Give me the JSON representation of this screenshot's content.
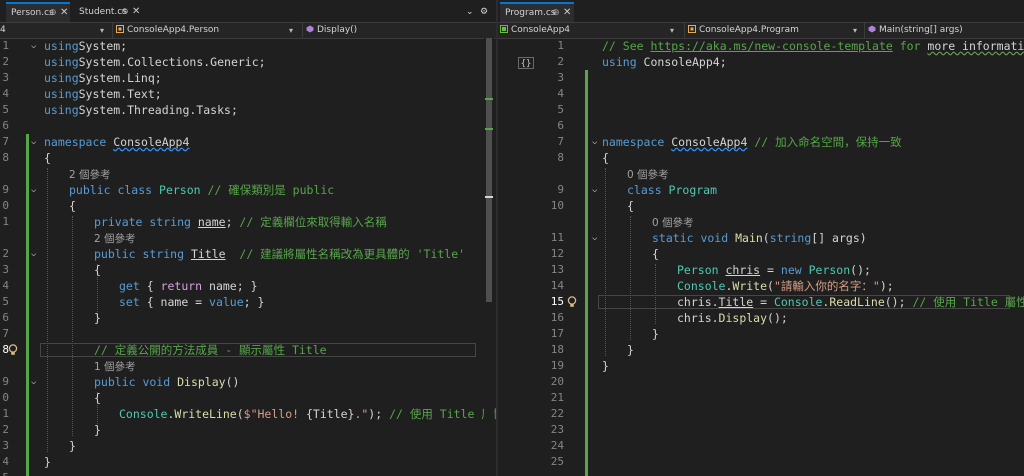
{
  "left": {
    "tabs": [
      {
        "label": "Person.cs",
        "active": true,
        "pin": "⊕",
        "close": "✕"
      },
      {
        "label": "Student.cs",
        "active": false,
        "pin": "⊕",
        "close": "✕"
      }
    ],
    "overflow_tab_icon": "⌄",
    "overflow_tab_icon_name": "tab-list-dropdown-icon",
    "settings_icon": "⚙",
    "settings_icon_name": "gear-icon",
    "nav": {
      "project": "4",
      "class": "ConsoleApp4.Person",
      "member": "Display()"
    },
    "lines": [
      {
        "n": "1",
        "fold": "⌵",
        "indent": 0,
        "segs": [
          [
            "kw",
            "using"
          ],
          [
            "",
            "System;"
          ]
        ]
      },
      {
        "n": "2",
        "indent": 0,
        "segs": [
          [
            "kw",
            "using"
          ],
          [
            "",
            "System.Collections.Generic;"
          ]
        ]
      },
      {
        "n": "3",
        "indent": 0,
        "segs": [
          [
            "kw",
            "using"
          ],
          [
            "",
            "System.Linq;"
          ]
        ]
      },
      {
        "n": "4",
        "indent": 0,
        "segs": [
          [
            "kw",
            "using"
          ],
          [
            "",
            "System.Text;"
          ]
        ]
      },
      {
        "n": "5",
        "indent": 0,
        "segs": [
          [
            "kw",
            "using"
          ],
          [
            "",
            "System.Threading.Tasks;"
          ]
        ]
      },
      {
        "n": "6",
        "indent": 0,
        "segs": []
      },
      {
        "n": "7",
        "fold": "⌵",
        "indent": 0,
        "segs": [
          [
            "kw",
            "namespace"
          ],
          [
            "",
            " "
          ],
          [
            "sq",
            "ConsoleApp4"
          ]
        ]
      },
      {
        "n": "8",
        "indent": 0,
        "segs": [
          [
            "",
            "{"
          ]
        ]
      },
      {
        "n": "",
        "indent": 1,
        "lens": "2 個參考"
      },
      {
        "n": "9",
        "fold": "⌵",
        "indent": 1,
        "segs": [
          [
            "kw",
            "public class "
          ],
          [
            "ty",
            "Person"
          ],
          [
            "cm",
            " // 確保類別是 public"
          ]
        ]
      },
      {
        "n": "0",
        "indent": 1,
        "segs": [
          [
            "",
            "{"
          ]
        ]
      },
      {
        "n": "1",
        "indent": 2,
        "segs": [
          [
            "kw",
            "private string "
          ],
          [
            "ul",
            "name"
          ],
          [
            "",
            ";"
          ],
          [
            "cm",
            " // 定義欄位來取得輸入名稱"
          ]
        ]
      },
      {
        "n": "",
        "indent": 2,
        "lens": "2 個參考"
      },
      {
        "n": "2",
        "fold": "⌵",
        "indent": 2,
        "segs": [
          [
            "kw",
            "public string "
          ],
          [
            "ul",
            "Title"
          ],
          [
            "cm",
            "  // 建議將屬性名稱改為更具體的 'Title'"
          ]
        ]
      },
      {
        "n": "3",
        "indent": 2,
        "segs": [
          [
            "",
            "{"
          ]
        ]
      },
      {
        "n": "4",
        "indent": 3,
        "segs": [
          [
            "kw",
            "get"
          ],
          [
            "",
            " { "
          ],
          [
            "ctl",
            "return"
          ],
          [
            "",
            " name; }"
          ]
        ]
      },
      {
        "n": "5",
        "indent": 3,
        "segs": [
          [
            "kw",
            "set"
          ],
          [
            "",
            " { name = "
          ],
          [
            "kw",
            "value"
          ],
          [
            "",
            "; }"
          ]
        ]
      },
      {
        "n": "6",
        "indent": 2,
        "segs": [
          [
            "",
            "}"
          ]
        ]
      },
      {
        "n": "7",
        "indent": 2,
        "segs": []
      },
      {
        "n": "8",
        "indent": 2,
        "current": true,
        "bulb": true,
        "segs": [
          [
            "cm",
            "// 定義公開的方法成員 - 顯示屬性 Title"
          ]
        ]
      },
      {
        "n": "",
        "indent": 2,
        "lens": "1 個參考"
      },
      {
        "n": "9",
        "fold": "⌵",
        "indent": 2,
        "segs": [
          [
            "kw",
            "public void "
          ],
          [
            "fn",
            "Display"
          ],
          [
            "",
            "()"
          ]
        ]
      },
      {
        "n": "0",
        "indent": 2,
        "segs": [
          [
            "",
            "{"
          ]
        ]
      },
      {
        "n": "1",
        "indent": 3,
        "segs": [
          [
            "ty",
            "Console"
          ],
          [
            "",
            "."
          ],
          [
            "fn",
            "WriteLine"
          ],
          [
            "",
            "("
          ],
          [
            "str",
            "$\"Hello! "
          ],
          [
            "",
            "{Title}"
          ],
          [
            "str",
            ".\""
          ],
          [
            "",
            ");"
          ],
          [
            "cm",
            " // 使用 Title 屬性"
          ]
        ]
      },
      {
        "n": "2",
        "indent": 2,
        "segs": [
          [
            "",
            "}"
          ]
        ]
      },
      {
        "n": "3",
        "indent": 1,
        "segs": [
          [
            "",
            "}"
          ]
        ]
      },
      {
        "n": "4",
        "indent": 0,
        "segs": [
          [
            "",
            "}"
          ]
        ]
      },
      {
        "n": "5",
        "indent": 0,
        "segs": []
      }
    ]
  },
  "right": {
    "tabs": [
      {
        "label": "Program.cs",
        "active": true,
        "pin": "⊕",
        "close": "✕"
      }
    ],
    "nav": {
      "project": "ConsoleApp4",
      "class": "ConsoleApp4.Program",
      "member": "Main(string[] args)"
    },
    "gutter_label": "{}",
    "lines": [
      {
        "n": "1",
        "indent": 0,
        "segs": [
          [
            "cm",
            "// See "
          ],
          [
            "lnk",
            "https://aka.ms/new-console-template"
          ],
          [
            "cm",
            " for "
          ],
          [
            "sqg",
            "more information"
          ]
        ]
      },
      {
        "n": "2",
        "indent": 0,
        "segs": [
          [
            "kw",
            "using"
          ],
          [
            "",
            " ConsoleApp4;"
          ]
        ]
      },
      {
        "n": "3",
        "indent": 0,
        "segs": []
      },
      {
        "n": "4",
        "indent": 0,
        "segs": []
      },
      {
        "n": "5",
        "indent": 0,
        "segs": []
      },
      {
        "n": "6",
        "indent": 0,
        "segs": []
      },
      {
        "n": "7",
        "fold": "⌵",
        "indent": 0,
        "segs": [
          [
            "kw",
            "namespace"
          ],
          [
            "",
            " "
          ],
          [
            "sq",
            "ConsoleApp4"
          ],
          [
            "cm",
            " // 加入命名空間，保持一致"
          ]
        ]
      },
      {
        "n": "8",
        "indent": 0,
        "segs": [
          [
            "",
            "{"
          ]
        ]
      },
      {
        "n": "",
        "indent": 1,
        "lens": "0 個參考"
      },
      {
        "n": "9",
        "fold": "⌵",
        "indent": 1,
        "segs": [
          [
            "kw",
            "class "
          ],
          [
            "ty",
            "Program"
          ]
        ]
      },
      {
        "n": "10",
        "indent": 1,
        "segs": [
          [
            "",
            "{"
          ]
        ]
      },
      {
        "n": "",
        "indent": 2,
        "lens": "0 個參考"
      },
      {
        "n": "11",
        "fold": "⌵",
        "indent": 2,
        "segs": [
          [
            "kw",
            "static void "
          ],
          [
            "fn",
            "Main"
          ],
          [
            "",
            "("
          ],
          [
            "kw",
            "string"
          ],
          [
            "",
            "[] args)"
          ]
        ]
      },
      {
        "n": "12",
        "indent": 2,
        "segs": [
          [
            "",
            "{"
          ]
        ]
      },
      {
        "n": "13",
        "indent": 3,
        "segs": [
          [
            "ty",
            "Person"
          ],
          [
            "",
            " "
          ],
          [
            "ul",
            "chris"
          ],
          [
            "",
            " = "
          ],
          [
            "kw",
            "new "
          ],
          [
            "ty",
            "Person"
          ],
          [
            "",
            "();"
          ]
        ]
      },
      {
        "n": "14",
        "indent": 3,
        "segs": [
          [
            "ty",
            "Console"
          ],
          [
            "",
            "."
          ],
          [
            "fn",
            "Write"
          ],
          [
            "",
            "("
          ],
          [
            "str",
            "\"請輸入你的名字：\""
          ],
          [
            "",
            ");"
          ]
        ]
      },
      {
        "n": "15",
        "indent": 3,
        "current": true,
        "bulb": true,
        "segs": [
          [
            "",
            "chris."
          ],
          [
            "ul",
            "Title"
          ],
          [
            "",
            " = "
          ],
          [
            "ty",
            "Console"
          ],
          [
            "",
            "."
          ],
          [
            "fn",
            "ReadLine"
          ],
          [
            "",
            "();"
          ],
          [
            "cm",
            " // 使用 Title 屬性"
          ]
        ]
      },
      {
        "n": "16",
        "indent": 3,
        "segs": [
          [
            "",
            "chris."
          ],
          [
            "fn",
            "Display"
          ],
          [
            "",
            "();"
          ]
        ]
      },
      {
        "n": "17",
        "indent": 2,
        "segs": [
          [
            "",
            "}"
          ]
        ]
      },
      {
        "n": "18",
        "indent": 1,
        "segs": [
          [
            "",
            "}"
          ]
        ]
      },
      {
        "n": "19",
        "indent": 0,
        "segs": [
          [
            "",
            "}"
          ]
        ]
      },
      {
        "n": "20",
        "indent": 0,
        "segs": []
      },
      {
        "n": "21",
        "indent": 0,
        "segs": []
      },
      {
        "n": "22",
        "indent": 0,
        "segs": []
      },
      {
        "n": "23",
        "indent": 0,
        "segs": []
      },
      {
        "n": "24",
        "indent": 0,
        "segs": []
      },
      {
        "n": "25",
        "indent": 0,
        "segs": []
      }
    ]
  },
  "colors": {
    "background": "#1f1f1f",
    "active_tab_accent": "#0078d4",
    "change_bar": "#57a64a",
    "comment": "#57a64a",
    "keyword": "#569cd6",
    "type": "#4ec9b0"
  }
}
